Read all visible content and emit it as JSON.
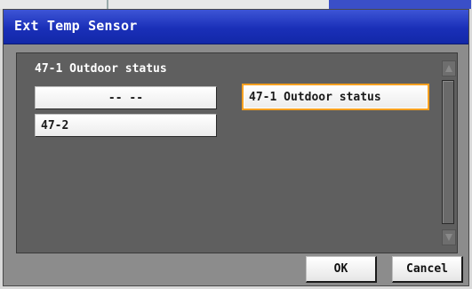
{
  "dialog": {
    "title": "Ext Temp Sensor",
    "current_selection": "47-1 Outdoor status"
  },
  "items": [
    {
      "label": "-- --",
      "selected": false
    },
    {
      "label": "47-1 Outdoor status",
      "selected": true
    },
    {
      "label": "47-2",
      "selected": false
    }
  ],
  "footer": {
    "ok_label": "OK",
    "cancel_label": "Cancel"
  },
  "colors": {
    "title_bar": "#1a2fb8",
    "selection_border": "#f5a020"
  },
  "icons": {
    "scroll_up": "scroll-up-arrow-icon",
    "scroll_down": "scroll-down-arrow-icon"
  }
}
